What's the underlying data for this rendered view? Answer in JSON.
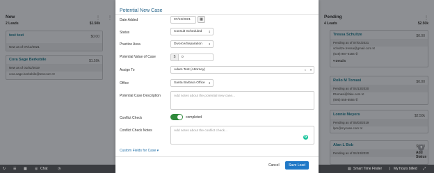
{
  "columns": {
    "left": {
      "title": "New",
      "leads": "2 Leads",
      "total": "$1.50k",
      "cards": [
        {
          "name": "test test",
          "amount": "$0.00",
          "as_of": "New as of 07/12/2021",
          "email": "",
          "phone": ""
        },
        {
          "name": "Cora Sage Berkebile",
          "amount": "$1.50k",
          "as_of": "New as of 01/02/2019",
          "email": "cora.sage.berkebile@test.com",
          "phone": ""
        }
      ]
    },
    "right": {
      "title": "Pending",
      "leads": "4 Leads",
      "total": "$2.50k",
      "cards": [
        {
          "name": "Tressa Schultze",
          "amount": "$0.00",
          "as_of": "Pending as of 07/01/2021",
          "email": "schultze.tressa@gmail.com",
          "phone": "(619) 987-0184",
          "details": "Details"
        },
        {
          "name": "Rollo M Tomasi",
          "amount": "$0.00",
          "as_of": "Pending as of 04/13/2020",
          "email": "Rtomasi@fake.com",
          "phone": "(805) 555-5555"
        },
        {
          "name": "Lonnie Meyers",
          "amount": "$2.50k",
          "as_of": "Pending as of 05/03/2019",
          "email": "lpm@mycase.com",
          "phone": ""
        },
        {
          "name": "Alan L Bob",
          "amount": "$0.00",
          "as_of": "Pending as of 04/13/2020",
          "email": "",
          "phone": ""
        }
      ]
    },
    "add_status": "Add Status"
  },
  "bottom_bar": {
    "chat": "Chat",
    "smart_time_finder": "Smart Time Finder",
    "hours_billed": "My hours billed"
  },
  "modal": {
    "title": "Potential New Case",
    "date_added_label": "Date Added",
    "date_added_value": "07/12/2021",
    "status_label": "Status",
    "status_value": "Consult Scheduled",
    "practice_area_label": "Practice Area",
    "practice_area_value": "Divorce/Separation",
    "value_label": "Potential Value of Case",
    "value_currency": "$",
    "value_value": "0",
    "assign_label": "Assign To",
    "assign_value": "Adam Test (Attorney)",
    "office_label": "Office",
    "office_value": "Santa Barbara Office",
    "description_label": "Potential Case Description",
    "description_placeholder": "Add notes about the potential new case...",
    "conflict_check_label": "Conflict Check",
    "conflict_check_state": "completed",
    "conflict_notes_label": "Conflict Check Notes",
    "conflict_notes_placeholder": "Add notes about the conflict check...",
    "custom_fields_link": "Custom Fields for Case ▾",
    "cancel_label": "Cancel",
    "save_label": "Save Lead"
  },
  "colors": {
    "save_button": "#1f78c7",
    "toggle_on": "#2f8a3b",
    "title_blue": "#1f5f86"
  }
}
